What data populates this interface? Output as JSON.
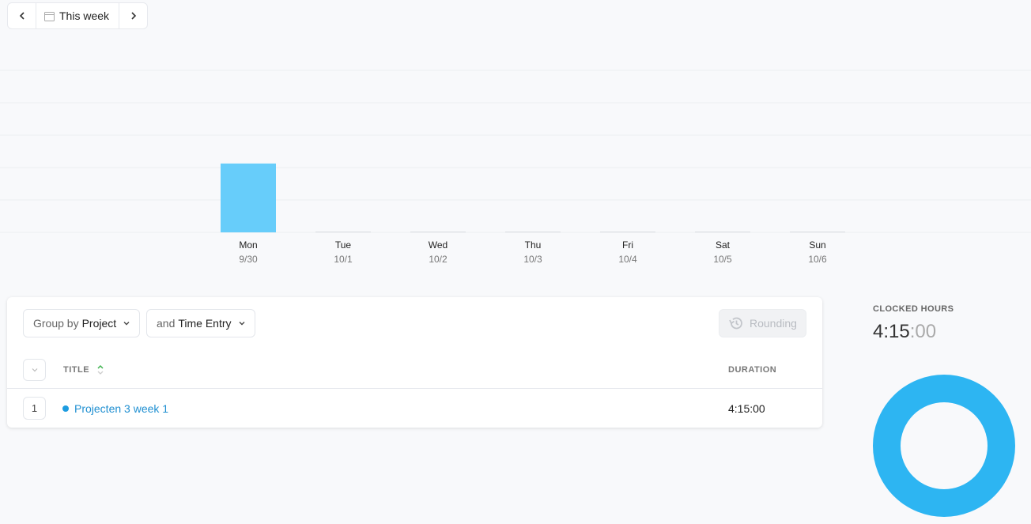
{
  "week_nav": {
    "prev_icon": "chevron-left-icon",
    "calendar_icon": "calendar-icon",
    "label": "This week",
    "next_icon": "chevron-right-icon"
  },
  "chart_data": {
    "type": "bar",
    "categories": [
      "Mon",
      "Tue",
      "Wed",
      "Thu",
      "Fri",
      "Sat",
      "Sun"
    ],
    "dates": [
      "9/30",
      "10/1",
      "10/2",
      "10/3",
      "10/4",
      "10/5",
      "10/6"
    ],
    "values": [
      4.25,
      0,
      0,
      0,
      0,
      0,
      0
    ],
    "ylim": [
      0,
      10
    ],
    "grid": true,
    "bar_color": "#67cdfa"
  },
  "report": {
    "group_by_prefix": "Group by",
    "group_by_value": "Project",
    "then_prefix": "and",
    "then_value": "Time Entry",
    "rounding_label": "Rounding",
    "columns": {
      "title": "TITLE",
      "duration": "DURATION"
    },
    "rows": [
      {
        "count": "1",
        "title": "Projecten 3 week 1",
        "duration": "4:15:00",
        "color": "#1d9ce0"
      }
    ]
  },
  "summary": {
    "label": "CLOCKED HOURS",
    "hm": "4:15",
    "sec": ":00",
    "donut_color": "#2db5f2",
    "donut_share": 1.0
  }
}
